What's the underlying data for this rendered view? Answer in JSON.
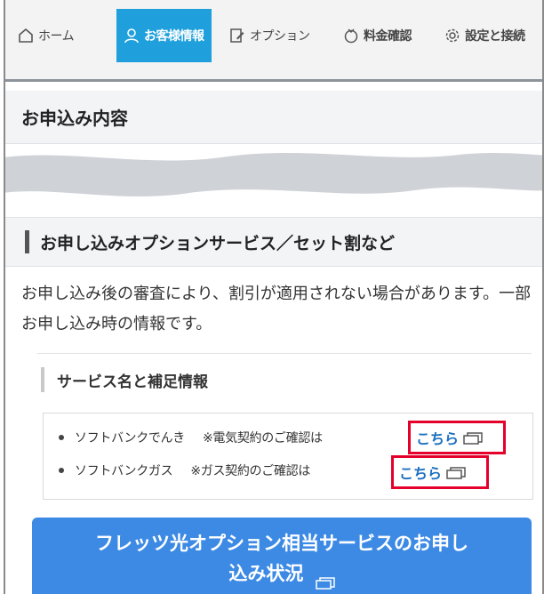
{
  "nav": {
    "tabs": [
      {
        "label": "ホーム",
        "icon": "home-icon",
        "active": false
      },
      {
        "label": "お客様情報",
        "icon": "user-icon",
        "active": true
      },
      {
        "label": "オプション",
        "icon": "edit-icon",
        "active": false
      },
      {
        "label": "料金確認",
        "icon": "coin-icon",
        "active": false
      },
      {
        "label": "設定と接続",
        "icon": "gear-icon",
        "active": false
      }
    ],
    "active_color": "#1fa0dc"
  },
  "section_title": "お申込み内容",
  "options": {
    "title": "お申し込みオプションサービス／セット割など",
    "description": "お申し込み後の審査により、割引が適用されない場合があります。一部お申し込み時の情報です。",
    "services_header": "サービス名と補足情報",
    "services": [
      {
        "name": "ソフトバンクでんき",
        "note": "※電気契約のご確認は",
        "link": "こちら"
      },
      {
        "name": "ソフトバンクガス",
        "note": "※ガス契約のご確認は",
        "link": "こちら"
      }
    ]
  },
  "cta": {
    "label_line1": "フレッツ光オプション相当サービスのお申し",
    "label_line2": "込み状況"
  },
  "colors": {
    "highlight_border": "#e4002b",
    "link": "#1b6fbf",
    "cta_bg": "#3d8ae5"
  }
}
